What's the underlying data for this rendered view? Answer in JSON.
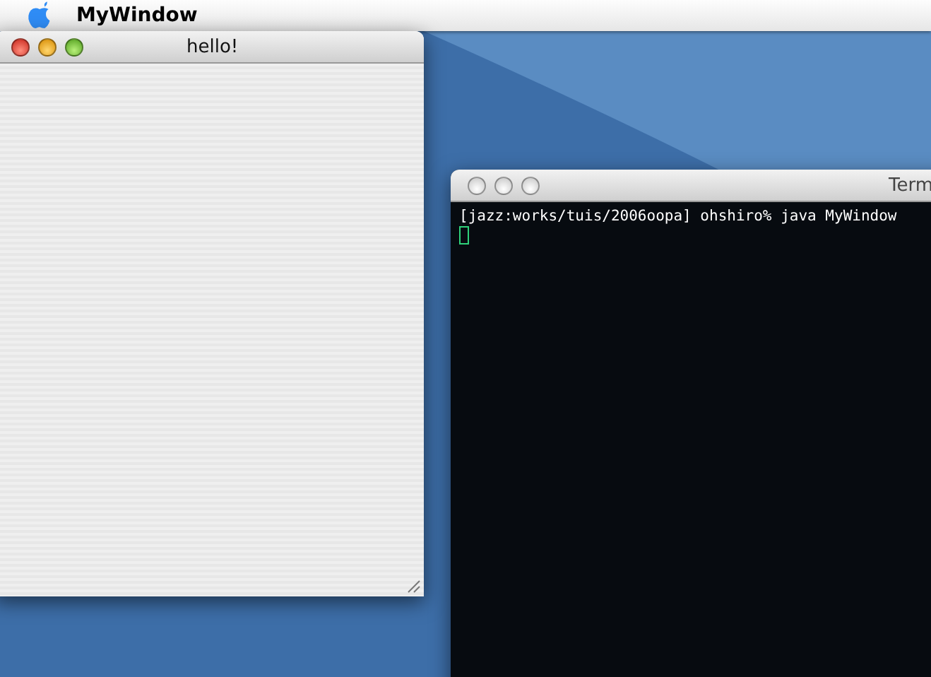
{
  "menu_bar": {
    "app_name": "MyWindow"
  },
  "windows": [
    {
      "kind": "blank",
      "title": "hello!",
      "active": true
    },
    {
      "kind": "terminal",
      "title": "Term",
      "active": false,
      "lines": [
        "[jazz:works/tuis/2006oopa] ohshiro% java MyWindow"
      ]
    }
  ]
}
